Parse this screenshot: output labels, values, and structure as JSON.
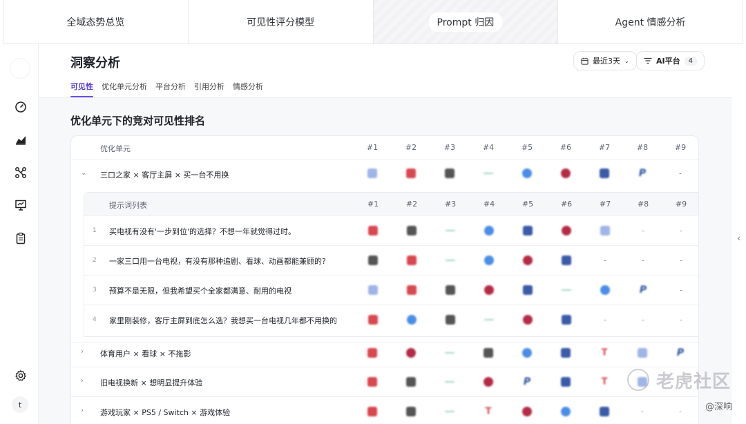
{
  "top_tabs": [
    {
      "label": "全域态势总览",
      "active": false
    },
    {
      "label": "可见性评分模型",
      "active": false
    },
    {
      "label": "Prompt 归因",
      "active": true
    },
    {
      "label": "Agent 情感分析",
      "active": false
    }
  ],
  "sidebar": {
    "icons": [
      "dashboard-icon",
      "chart-area-icon",
      "network-icon",
      "presentation-icon",
      "clipboard-icon"
    ],
    "settings_icon": "gear-icon",
    "avatar_initial": "t"
  },
  "header": {
    "title": "洞察分析",
    "tabs": [
      {
        "label": "可见性",
        "active": true
      },
      {
        "label": "优化单元分析",
        "active": false
      },
      {
        "label": "平台分析",
        "active": false
      },
      {
        "label": "引用分析",
        "active": false
      },
      {
        "label": "情感分析",
        "active": false
      }
    ],
    "date_button": "最近3天",
    "platform_button": "AI平台",
    "platform_count": "4"
  },
  "section": {
    "title": "优化单元下的竞对可见性排名"
  },
  "table": {
    "unit_header": "优化单元",
    "rank_headers": [
      "#1",
      "#2",
      "#3",
      "#4",
      "#5",
      "#6",
      "#7",
      "#8",
      "#9"
    ],
    "subtable_header": "提示词列表",
    "units": [
      {
        "label": "三口之家 × 客厅主屏 × 买一台不用换",
        "expanded": true,
        "icons": [
          "blue-sq",
          "red-sq",
          "gray-sq",
          "dash",
          "blue-circle",
          "red-circle",
          "navy-sq",
          "P",
          "-"
        ],
        "prompts": [
          {
            "idx": "1",
            "text": "买电视有没有'一步到位'的选择？不想一年就觉得过时。",
            "icons": [
              "red-sq",
              "gray-sq",
              "dash",
              "blue-circle",
              "navy-sq",
              "red-circle",
              "blue-sq",
              "-",
              "-"
            ]
          },
          {
            "idx": "2",
            "text": "一家三口用一台电视，有没有那种追剧、看球、动画都能兼顾的?",
            "icons": [
              "gray-sq",
              "red-sq",
              "dash",
              "blue-circle",
              "red-circle",
              "navy-sq",
              "-",
              "-",
              "-"
            ]
          },
          {
            "idx": "3",
            "text": "预算不是无限，但我希望买个全家都满意、耐用的电视",
            "icons": [
              "blue-sq",
              "red-sq",
              "gray-sq",
              "red-circle",
              "navy-sq",
              "dash",
              "blue-circle",
              "P",
              "-"
            ]
          },
          {
            "idx": "4",
            "text": "家里刚装修，客厅主屏到底怎么选？我想买一台电视几年都不用换的",
            "icons": [
              "red-sq",
              "blue-circle",
              "gray-sq",
              "dash",
              "red-circle",
              "navy-sq",
              "-",
              "-",
              "-"
            ]
          }
        ]
      },
      {
        "label": "体育用户 × 看球 × 不拖影",
        "expanded": false,
        "icons": [
          "red-sq",
          "red-circle",
          "dash",
          "gray-sq",
          "blue-circle",
          "navy-sq",
          "T",
          "blue-sq",
          "P"
        ]
      },
      {
        "label": "旧电视换新 × 想明显提升体验",
        "expanded": false,
        "icons": [
          "red-sq",
          "gray-sq",
          "dash",
          "red-circle",
          "P",
          "navy-sq",
          "T",
          "blue-sq",
          "-"
        ]
      },
      {
        "label": "游戏玩家 × PS5 / Switch × 游戏体验",
        "expanded": false,
        "icons": [
          "red-sq",
          "gray-sq",
          "dash",
          "T",
          "red-circle",
          "blue-circle",
          "navy-sq",
          "-",
          "-"
        ]
      }
    ]
  },
  "watermark": {
    "main": "老虎社区",
    "sub": "@深响"
  },
  "colors": {
    "accent": "#6a4ee8",
    "red": "#d9474f",
    "blue": "#4a8de8",
    "navy": "#3b5aa8",
    "gray": "#555555",
    "crimson": "#b52a45",
    "mint": "#9fd8c2"
  }
}
